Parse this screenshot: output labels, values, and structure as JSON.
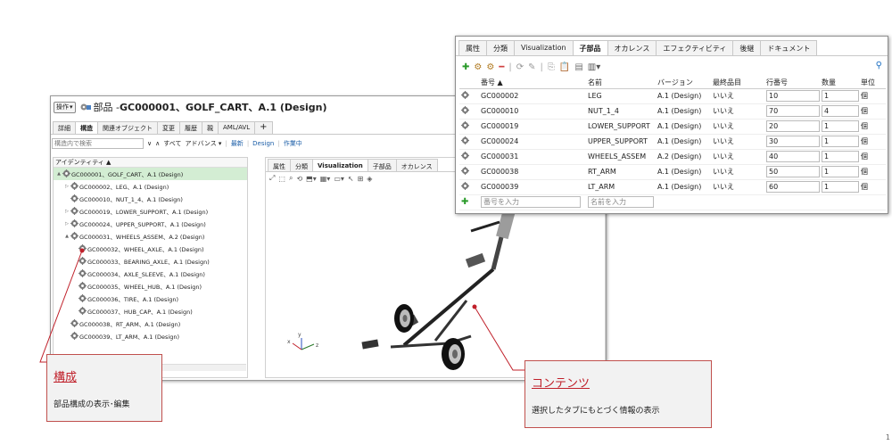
{
  "main_window": {
    "ops_button": "操作",
    "title_prefix": "部品 - ",
    "title": "GC000001、GOLF_CART、A.1 (Design)",
    "tabs": [
      "詳細",
      "構造",
      "関連オブジェクト",
      "変更",
      "履歴",
      "親",
      "AML/AVL",
      "+"
    ],
    "active_tab": "構造",
    "toolbar": {
      "search_placeholder": "構造内で検索",
      "all_label": "すべて",
      "advanced_label": "アドバンス",
      "latest_label": "最新",
      "design_label": "Design",
      "working_label": "作業中"
    },
    "tree": {
      "header": "アイデンティティ",
      "rows": [
        {
          "label": "GC000001、GOLF_CART、A.1 (Design)",
          "twist": "▲",
          "indent": 0,
          "selected": true
        },
        {
          "label": "GC000002、LEG、A.1 (Design)",
          "twist": "▷",
          "indent": 1
        },
        {
          "label": "GC000010、NUT_1_4、A.1 (Design)",
          "twist": "",
          "indent": 1
        },
        {
          "label": "GC000019、LOWER_SUPPORT、A.1 (Design)",
          "twist": "▷",
          "indent": 1
        },
        {
          "label": "GC000024、UPPER_SUPPORT、A.1 (Design)",
          "twist": "▷",
          "indent": 1
        },
        {
          "label": "GC000031、WHEELS_ASSEM、A.2 (Design)",
          "twist": "▲",
          "indent": 1
        },
        {
          "label": "GC000032、WHEEL_AXLE、A.1 (Design)",
          "twist": "",
          "indent": 2
        },
        {
          "label": "GC000033、BEARING_AXLE、A.1 (Design)",
          "twist": "",
          "indent": 2
        },
        {
          "label": "GC000034、AXLE_SLEEVE、A.1 (Design)",
          "twist": "",
          "indent": 2
        },
        {
          "label": "GC000035、WHEEL_HUB、A.1 (Design)",
          "twist": "",
          "indent": 2
        },
        {
          "label": "GC000036、TIRE、A.1 (Design)",
          "twist": "",
          "indent": 2
        },
        {
          "label": "GC000037、HUB_CAP、A.1 (Design)",
          "twist": "",
          "indent": 2
        },
        {
          "label": "GC000038、RT_ARM、A.1 (Design)",
          "twist": "",
          "indent": 1
        },
        {
          "label": "GC000039、LT_ARM、A.1 (Design)",
          "twist": "",
          "indent": 1
        }
      ]
    },
    "viz_tabs": [
      "属性",
      "分類",
      "Visualization",
      "子部品",
      "オカレンス"
    ],
    "viz_active_tab": "Visualization",
    "axis_labels": {
      "x": "x",
      "y": "y",
      "z": "z"
    }
  },
  "child_window": {
    "tabs": [
      "属性",
      "分類",
      "Visualization",
      "子部品",
      "オカレンス",
      "エフェクティビティ",
      "後継",
      "ドキュメント"
    ],
    "active_tab": "子部品",
    "columns": [
      "番号",
      "名前",
      "バージョン",
      "最終品目",
      "行番号",
      "数量",
      "単位"
    ],
    "rows": [
      {
        "number": "GC000002",
        "name": "LEG",
        "version": "A.1 (Design)",
        "end_item": "いいえ",
        "line": "10",
        "qty": "1",
        "unit": "個"
      },
      {
        "number": "GC000010",
        "name": "NUT_1_4",
        "version": "A.1 (Design)",
        "end_item": "いいえ",
        "line": "70",
        "qty": "4",
        "unit": "個"
      },
      {
        "number": "GC000019",
        "name": "LOWER_SUPPORT",
        "version": "A.1 (Design)",
        "end_item": "いいえ",
        "line": "20",
        "qty": "1",
        "unit": "個"
      },
      {
        "number": "GC000024",
        "name": "UPPER_SUPPORT",
        "version": "A.1 (Design)",
        "end_item": "いいえ",
        "line": "30",
        "qty": "1",
        "unit": "個"
      },
      {
        "number": "GC000031",
        "name": "WHEELS_ASSEM",
        "version": "A.2 (Design)",
        "end_item": "いいえ",
        "line": "40",
        "qty": "1",
        "unit": "個"
      },
      {
        "number": "GC000038",
        "name": "RT_ARM",
        "version": "A.1 (Design)",
        "end_item": "いいえ",
        "line": "50",
        "qty": "1",
        "unit": "個"
      },
      {
        "number": "GC000039",
        "name": "LT_ARM",
        "version": "A.1 (Design)",
        "end_item": "いいえ",
        "line": "60",
        "qty": "1",
        "unit": "個"
      }
    ],
    "number_placeholder": "番号を入力",
    "name_placeholder": "名前を入力"
  },
  "callouts": {
    "structure_title": "構成",
    "structure_desc": "部品構成の表示･編集",
    "content_title": "コンテンツ",
    "content_desc": "選択したタブにもとづく情報の表示"
  },
  "page_number": "1",
  "colors": {
    "accent_red": "#c0202a",
    "selected_row": "#d3edd3",
    "link_blue": "#1d5fa8"
  }
}
